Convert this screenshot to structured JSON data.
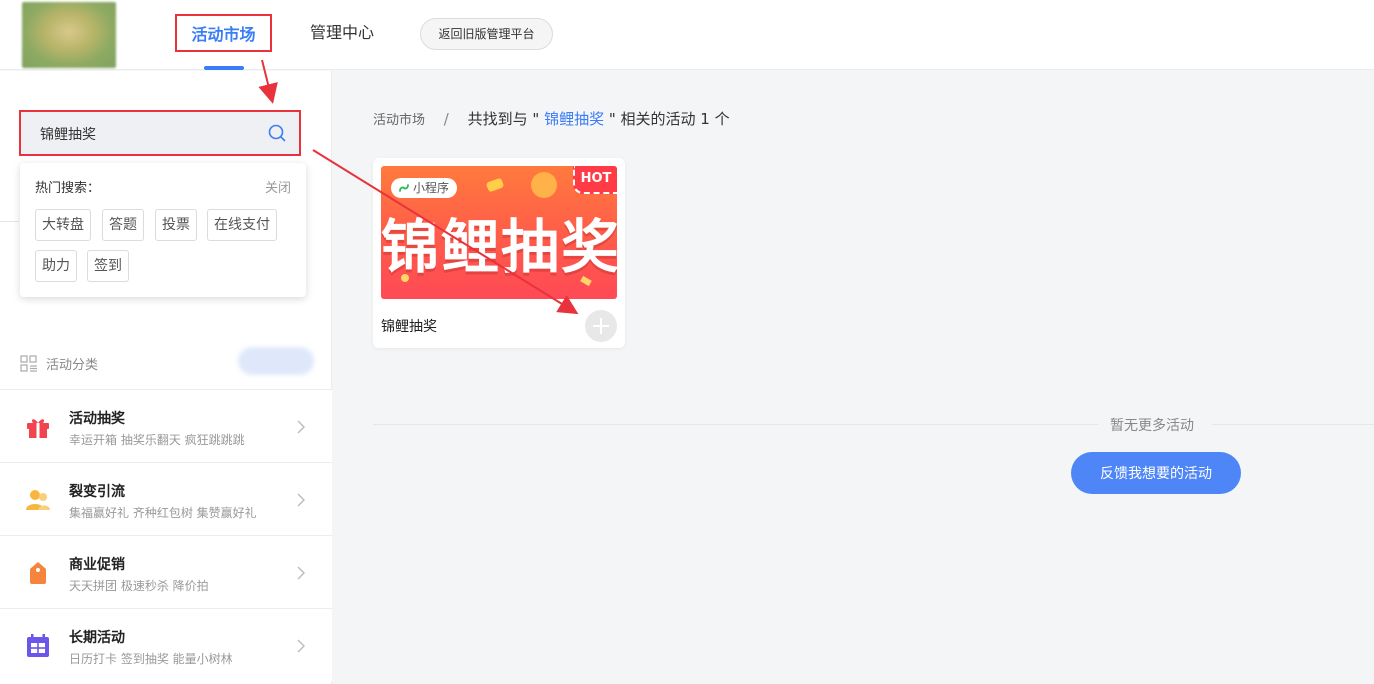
{
  "header": {
    "tabs": [
      {
        "label": "活动市场",
        "active": true
      },
      {
        "label": "管理中心",
        "active": false
      }
    ],
    "old_platform_label": "返回旧版管理平台"
  },
  "sidebar": {
    "search": {
      "value": "锦鲤抽奖",
      "placeholder": ""
    },
    "hot_search": {
      "title": "热门搜索：",
      "close_label": "关闭",
      "tags": [
        "大转盘",
        "答题",
        "投票",
        "在线支付",
        "助力",
        "签到"
      ]
    },
    "category_title": "活动分类",
    "categories": [
      {
        "title": "活动抽奖",
        "subtitle": "幸运开箱  抽奖乐翻天  疯狂跳跳跳",
        "icon": "gift-icon"
      },
      {
        "title": "裂变引流",
        "subtitle": "集福赢好礼  齐种红包树  集赞赢好礼",
        "icon": "users-icon"
      },
      {
        "title": "商业促销",
        "subtitle": "天天拼团  极速秒杀  降价拍",
        "icon": "price-tag-icon"
      },
      {
        "title": "长期活动",
        "subtitle": "日历打卡  签到抽奖  能量小树林",
        "icon": "calendar-icon"
      }
    ]
  },
  "main": {
    "breadcrumb": {
      "home": "活动市场",
      "separator": "/",
      "prefix": "共找到与 \" ",
      "keyword": "锦鲤抽奖",
      "suffix": " \" 相关的活动 1 个"
    },
    "results": [
      {
        "title": "锦鲤抽奖",
        "banner_text": "锦鲤抽奖",
        "mini_program_label": "小程序",
        "hot_label": "HOT"
      }
    ],
    "no_more_text": "暂无更多活动",
    "feedback_label": "反馈我想要的活动"
  },
  "colors": {
    "accent": "#3b7cf7",
    "annotation_red": "#e8323c",
    "banner": "#ff5b4a"
  }
}
